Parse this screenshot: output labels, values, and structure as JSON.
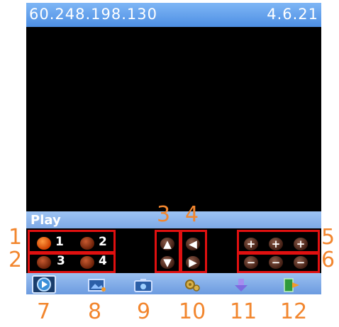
{
  "titlebar": {
    "ip": "60.248.198.130",
    "version": "4.6.21"
  },
  "playbar": {
    "label": "Play"
  },
  "channels": [
    {
      "label": "1",
      "active": true
    },
    {
      "label": "2",
      "active": false
    },
    {
      "label": "3",
      "active": false
    },
    {
      "label": "4",
      "active": false
    }
  ],
  "ptz": {
    "up": "▲",
    "down": "▼",
    "left": "◀",
    "right": "▶"
  },
  "zoom": {
    "plus": "+",
    "minus": "−"
  },
  "toolbar": {
    "icons": [
      "play-icon",
      "picture-icon",
      "camera-icon",
      "settings-icon",
      "download-icon",
      "exit-icon"
    ]
  },
  "annotations": [
    "1",
    "2",
    "3",
    "4",
    "5",
    "6",
    "7",
    "8",
    "9",
    "10",
    "11",
    "12"
  ],
  "colors": {
    "annotation": "#f2862e",
    "highlight_box": "#e01010",
    "titlebar": "#4d8fe4"
  }
}
